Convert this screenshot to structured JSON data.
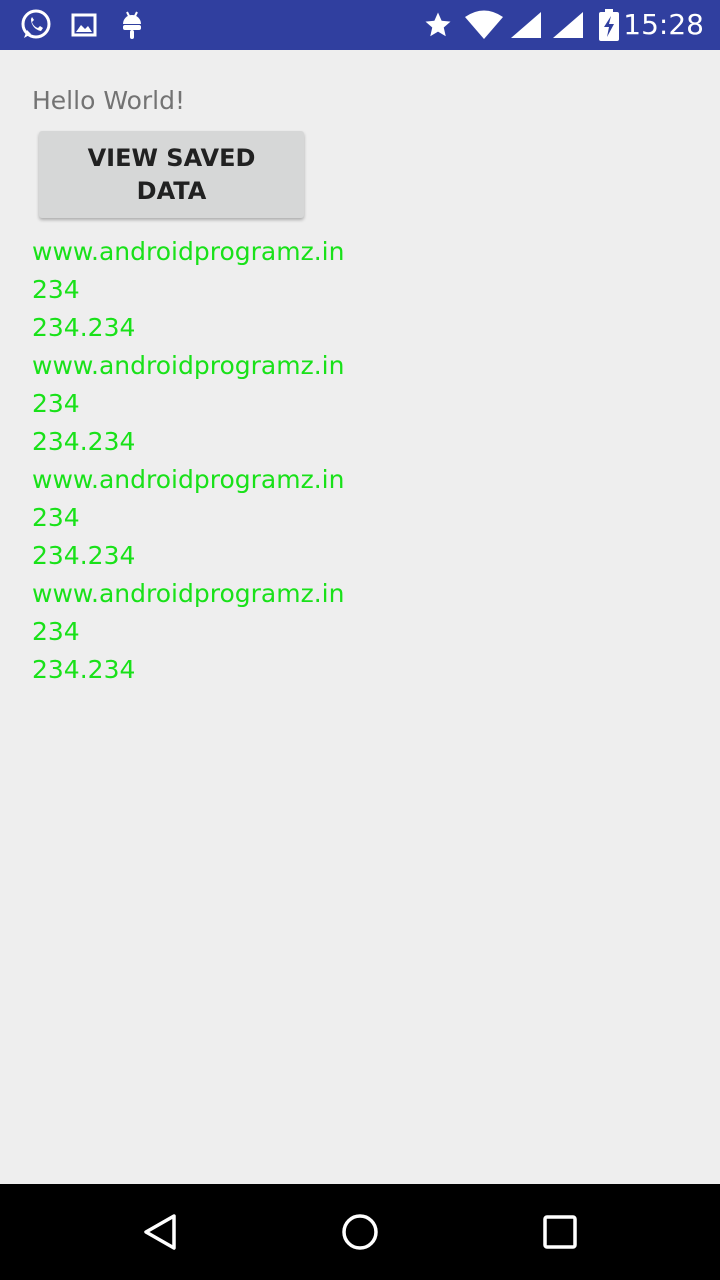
{
  "status_bar": {
    "time": "15:28",
    "background": "#303f9f",
    "icons_left": [
      "whatsapp-icon",
      "image-icon",
      "android-debug-icon"
    ],
    "icons_right": [
      "star-icon",
      "wifi-icon",
      "signal-icon",
      "signal-icon",
      "battery-charging-icon"
    ]
  },
  "main": {
    "greeting": "Hello World!",
    "view_button_label": "VIEW SAVED DATA",
    "records": [
      {
        "url": "www.androidprogramz.in",
        "int_value": "234",
        "float_value": "234.234"
      },
      {
        "url": "www.androidprogramz.in",
        "int_value": "234",
        "float_value": "234.234"
      },
      {
        "url": "www.androidprogramz.in",
        "int_value": "234",
        "float_value": "234.234"
      },
      {
        "url": "www.androidprogramz.in",
        "int_value": "234",
        "float_value": "234.234"
      }
    ],
    "record_color": "#19e119"
  },
  "nav_bar": {
    "buttons": [
      "back-icon",
      "home-icon",
      "recents-icon"
    ]
  }
}
